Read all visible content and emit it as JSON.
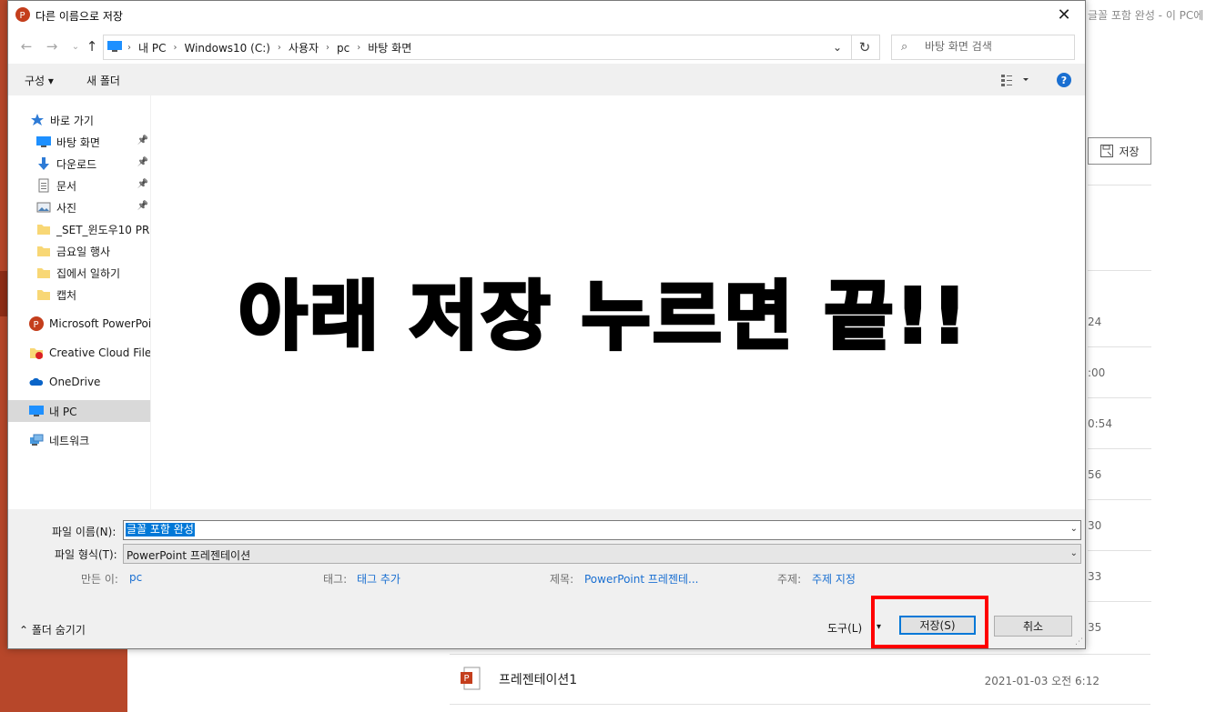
{
  "background": {
    "window_title": "글꼴 포함 완성  -  이 PC에",
    "save_label": "저장",
    "times": [
      "24",
      ":00",
      "0:54",
      "56",
      "30",
      "33",
      "35"
    ],
    "last_file": {
      "name": "프레젠테이션1",
      "date": "2021-01-03 오전 6:12"
    }
  },
  "dialog": {
    "title": "다른 이름으로 저장",
    "close_icon": "close-icon",
    "breadcrumbs": [
      "내 PC",
      "Windows10 (C:)",
      "사용자",
      "pc",
      "바탕 화면"
    ],
    "search_placeholder": "바탕 화면 검색",
    "toolbar": {
      "organize": "구성 ▾",
      "new_folder": "새 폴더",
      "help": "?"
    },
    "sidebar": [
      {
        "label": "바로 가기",
        "icon": "star-icon"
      },
      {
        "label": "바탕 화면",
        "icon": "desktop-icon",
        "pinned": true
      },
      {
        "label": "다운로드",
        "icon": "download-icon",
        "pinned": true
      },
      {
        "label": "문서",
        "icon": "document-icon",
        "pinned": true
      },
      {
        "label": "사진",
        "icon": "picture-icon",
        "pinned": true
      },
      {
        "label": "_SET_윈도우10 PRO",
        "icon": "folder-icon"
      },
      {
        "label": "금요일 행사",
        "icon": "folder-icon"
      },
      {
        "label": "집에서 일하기",
        "icon": "folder-icon"
      },
      {
        "label": "캡처",
        "icon": "folder-icon"
      },
      {
        "label": "Microsoft PowerPoint",
        "icon": "powerpoint-icon"
      },
      {
        "label": "Creative Cloud Files",
        "icon": "creative-cloud-icon"
      },
      {
        "label": "OneDrive",
        "icon": "onedrive-icon"
      },
      {
        "label": "내 PC",
        "icon": "pc-icon",
        "selected": true
      },
      {
        "label": "네트워크",
        "icon": "network-icon"
      }
    ],
    "overlay_text": "아래 저장 누르면 끝!!",
    "file_name_label": "파일 이름(N):",
    "file_name_value": "글꼴 포함 완성",
    "file_type_label": "파일 형식(T):",
    "file_type_value": "PowerPoint 프레젠테이션",
    "meta": {
      "author_label": "만든 이:",
      "author_value": "pc",
      "tags_label": "태그:",
      "tags_value": "태그 추가",
      "title_label": "제목:",
      "title_value": "PowerPoint 프레젠테...",
      "subject_label": "주제:",
      "subject_value": "주제 지정"
    },
    "hide_folders": "⌃  폴더 숨기기",
    "tools_label": "도구(L)",
    "save_button": "저장(S)",
    "cancel_button": "취소"
  },
  "colors": {
    "accent": "#0078d7",
    "highlight": "#ff0000",
    "ppt": "#b7472a"
  }
}
